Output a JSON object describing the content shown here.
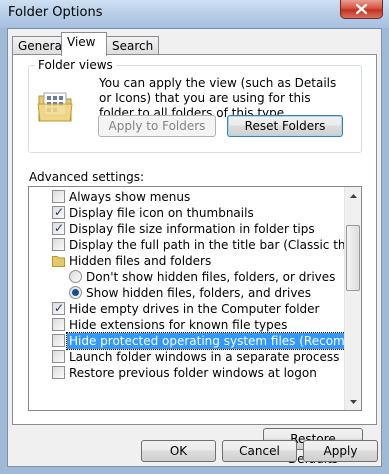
{
  "window": {
    "title": "Folder Options"
  },
  "tabs": [
    {
      "label": "General",
      "active": false
    },
    {
      "label": "View",
      "active": true
    },
    {
      "label": "Search",
      "active": false
    }
  ],
  "folder_views": {
    "title": "Folder views",
    "description": "You can apply the view (such as Details or Icons) that you are using for this folder to all folders of this type.",
    "apply_label": "Apply to Folders",
    "reset_label": "Reset Folders",
    "icon": "folder-views-icon"
  },
  "advanced": {
    "label": "Advanced settings:",
    "items": [
      {
        "type": "checkbox",
        "label": "Always show menus",
        "checked": false,
        "level": 0
      },
      {
        "type": "checkbox",
        "label": "Display file icon on thumbnails",
        "checked": true,
        "level": 0
      },
      {
        "type": "checkbox",
        "label": "Display file size information in folder tips",
        "checked": true,
        "level": 0
      },
      {
        "type": "checkbox",
        "label": "Display the full path in the title bar (Classic theme only)",
        "checked": false,
        "level": 0
      },
      {
        "type": "folder",
        "label": "Hidden files and folders",
        "level": 0
      },
      {
        "type": "radio",
        "label": "Don't show hidden files, folders, or drives",
        "checked": false,
        "level": 1
      },
      {
        "type": "radio",
        "label": "Show hidden files, folders, and drives",
        "checked": true,
        "level": 1
      },
      {
        "type": "checkbox",
        "label": "Hide empty drives in the Computer folder",
        "checked": true,
        "level": 0
      },
      {
        "type": "checkbox",
        "label": "Hide extensions for known file types",
        "checked": false,
        "level": 0
      },
      {
        "type": "checkbox",
        "label": "Hide protected operating system files (Recommended)",
        "checked": false,
        "level": 0,
        "selected": true
      },
      {
        "type": "checkbox",
        "label": "Launch folder windows in a separate process",
        "checked": false,
        "level": 0
      },
      {
        "type": "checkbox",
        "label": "Restore previous folder windows at logon",
        "checked": false,
        "level": 0
      }
    ]
  },
  "buttons": {
    "restore_defaults": "Restore Defaults",
    "ok": "OK",
    "cancel": "Cancel",
    "apply": "Apply"
  },
  "colors": {
    "selection": "#3399ff",
    "close_button": "#c43220",
    "titlebar": "#b7cde7"
  }
}
